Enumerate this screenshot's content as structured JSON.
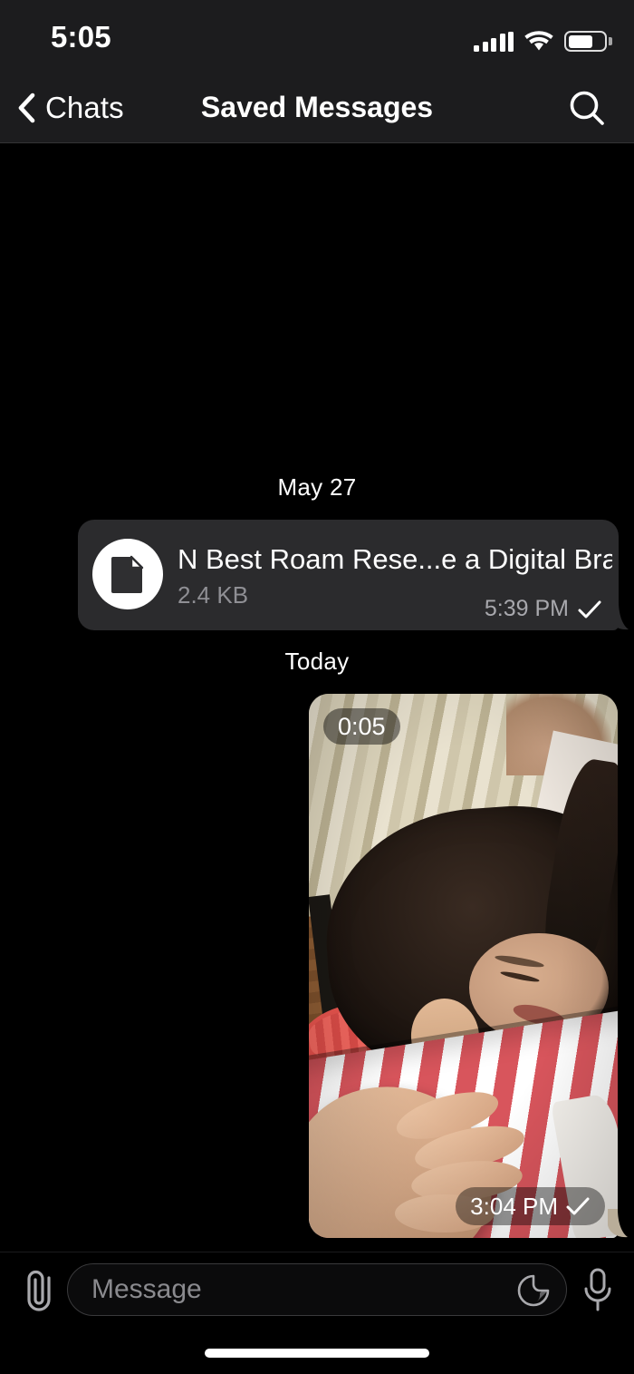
{
  "status_bar": {
    "time": "5:05",
    "signal_icon": "cellular-signal-icon",
    "wifi_icon": "wifi-icon",
    "battery_icon": "battery-icon",
    "battery_level_percent": 70
  },
  "nav_bar": {
    "back_label": "Chats",
    "back_icon": "chevron-left-icon",
    "title": "Saved Messages",
    "search_icon": "search-icon"
  },
  "conversation": {
    "dividers": {
      "first": "May 27",
      "second": "Today"
    },
    "file_message": {
      "icon": "document-icon",
      "name": "N Best Roam Rese...e a Digital Brain.txt",
      "size": "2.4 KB",
      "time": "5:39 PM",
      "status_icon": "check-icon"
    },
    "video_message": {
      "duration": "0:05",
      "time": "3:04 PM",
      "status_icon": "check-icon"
    }
  },
  "input_bar": {
    "attach_icon": "paperclip-icon",
    "placeholder": "Message",
    "value": "",
    "sticker_icon": "sticker-icon",
    "mic_icon": "microphone-icon"
  },
  "colors": {
    "background": "#000000",
    "chrome": "#1c1c1e",
    "bubble_incoming": "#2b2b2d",
    "text_primary": "#ffffff",
    "text_secondary": "#8f8f94"
  }
}
